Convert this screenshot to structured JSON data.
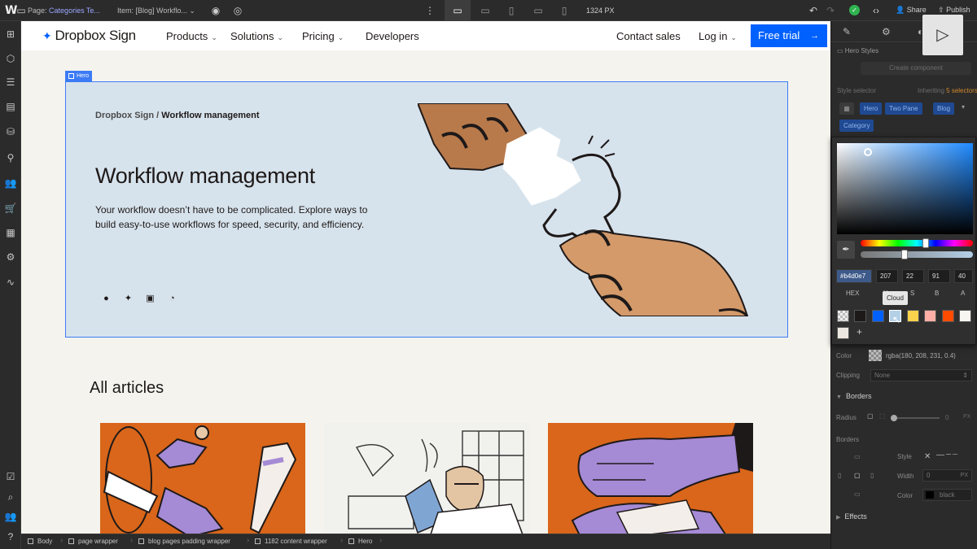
{
  "app": {
    "page_label": "Page:",
    "page_value": "Categories Te...",
    "item_label": "Item:",
    "item_value": "[Blog] Workflo...",
    "width_readout": "1324 PX",
    "share": "Share",
    "publish": "Publish"
  },
  "site": {
    "brand": "Dropbox Sign",
    "nav": [
      "Products",
      "Solutions",
      "Pricing",
      "Developers"
    ],
    "contact": "Contact sales",
    "login": "Log in",
    "cta": "Free trial",
    "hero_tag": "Hero",
    "crumb_parent": "Dropbox Sign /",
    "crumb_current": "Workflow management",
    "title": "Workflow management",
    "description": "Your workflow doesn’t have to be complicated. Explore ways to build easy-to-use workflows for speed, security, and efficiency.",
    "all_articles": "All articles"
  },
  "breadcrumbs": [
    "Body",
    "page wrapper",
    "blog pages padding wrapper",
    "1182 content wrapper",
    "Hero"
  ],
  "style_panel": {
    "hero_styles": "Hero Styles",
    "create_component": "Create component",
    "style_selector": "Style selector",
    "inheriting": "Inheriting",
    "inheriting_count": "5 selectors",
    "selectors": [
      "Hero",
      "Two Pane",
      "Blog",
      "Category"
    ]
  },
  "color_picker": {
    "hex_value": "#b4d0e7",
    "r": "207",
    "g": "22",
    "b": "91",
    "a": "40",
    "labels": [
      "HEX",
      "H",
      "S",
      "B",
      "A"
    ],
    "tooltip": "Cloud",
    "swatches": [
      "transparent",
      "#1e1919",
      "#0061fe",
      "#b4d0e7",
      "#fad24b",
      "#ffafa5",
      "#ff4b00",
      "#f7f5f2",
      "#ece7e0"
    ]
  },
  "properties": {
    "color_label": "Color",
    "color_value": "rgba(180, 208, 231, 0.4)",
    "clipping_label": "Clipping",
    "clipping_value": "None",
    "borders_section": "Borders",
    "radius_label": "Radius",
    "radius_value": "0",
    "radius_unit": "PX",
    "borders_label": "Borders",
    "style_label": "Style",
    "width_label": "Width",
    "width_value": "0",
    "width_unit": "PX",
    "border_color_label": "Color",
    "border_color_value": "black",
    "effects_section": "Effects"
  }
}
